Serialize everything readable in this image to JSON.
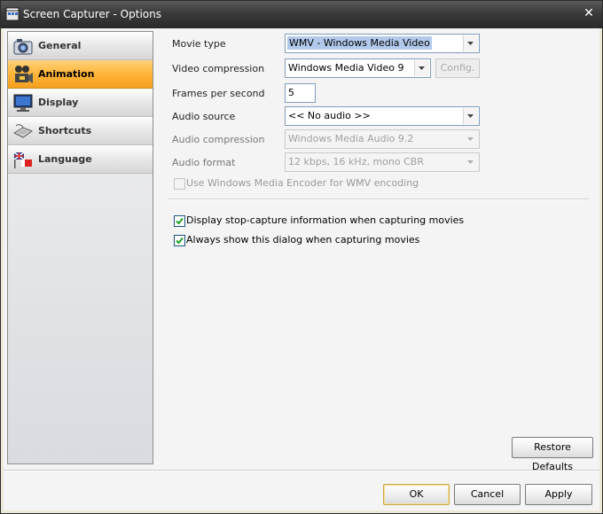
{
  "window": {
    "title": "Screen Capturer - Options",
    "close_glyph": "✕"
  },
  "sidebar": {
    "items": [
      {
        "label": "General",
        "icon": "camera-icon",
        "active": false
      },
      {
        "label": "Animation",
        "icon": "film-camera-icon",
        "active": true
      },
      {
        "label": "Display",
        "icon": "monitor-icon",
        "active": false
      },
      {
        "label": "Shortcuts",
        "icon": "keyboard-icon",
        "active": false
      },
      {
        "label": "Language",
        "icon": "flag-icon",
        "active": false
      }
    ]
  },
  "form": {
    "movie_type": {
      "label": "Movie type",
      "value": "WMV - Windows Media Video"
    },
    "video_compression": {
      "label": "Video compression",
      "value": "Windows Media Video 9",
      "config_label": "Config."
    },
    "fps": {
      "label": "Frames per second",
      "value": "5"
    },
    "audio_source": {
      "label": "Audio source",
      "value": "<< No audio >>"
    },
    "audio_compression": {
      "label": "Audio compression",
      "value": "Windows Media Audio 9.2"
    },
    "audio_format": {
      "label": "Audio format",
      "value": "12 kbps, 16 kHz, mono CBR"
    },
    "use_encoder": {
      "label": "Use Windows Media Encoder for WMV encoding",
      "checked": false,
      "enabled": false
    },
    "display_stop_info": {
      "label": "Display stop-capture information when capturing movies",
      "checked": true
    },
    "always_show_dialog": {
      "label": "Always show this dialog when capturing movies",
      "checked": true
    }
  },
  "buttons": {
    "restore": "Restore Defaults",
    "ok": "OK",
    "cancel": "Cancel",
    "apply": "Apply"
  },
  "colors": {
    "active_nav": "#ffb53a",
    "titlebar": "#3a3a3a",
    "selection": "#b2c9ec"
  }
}
